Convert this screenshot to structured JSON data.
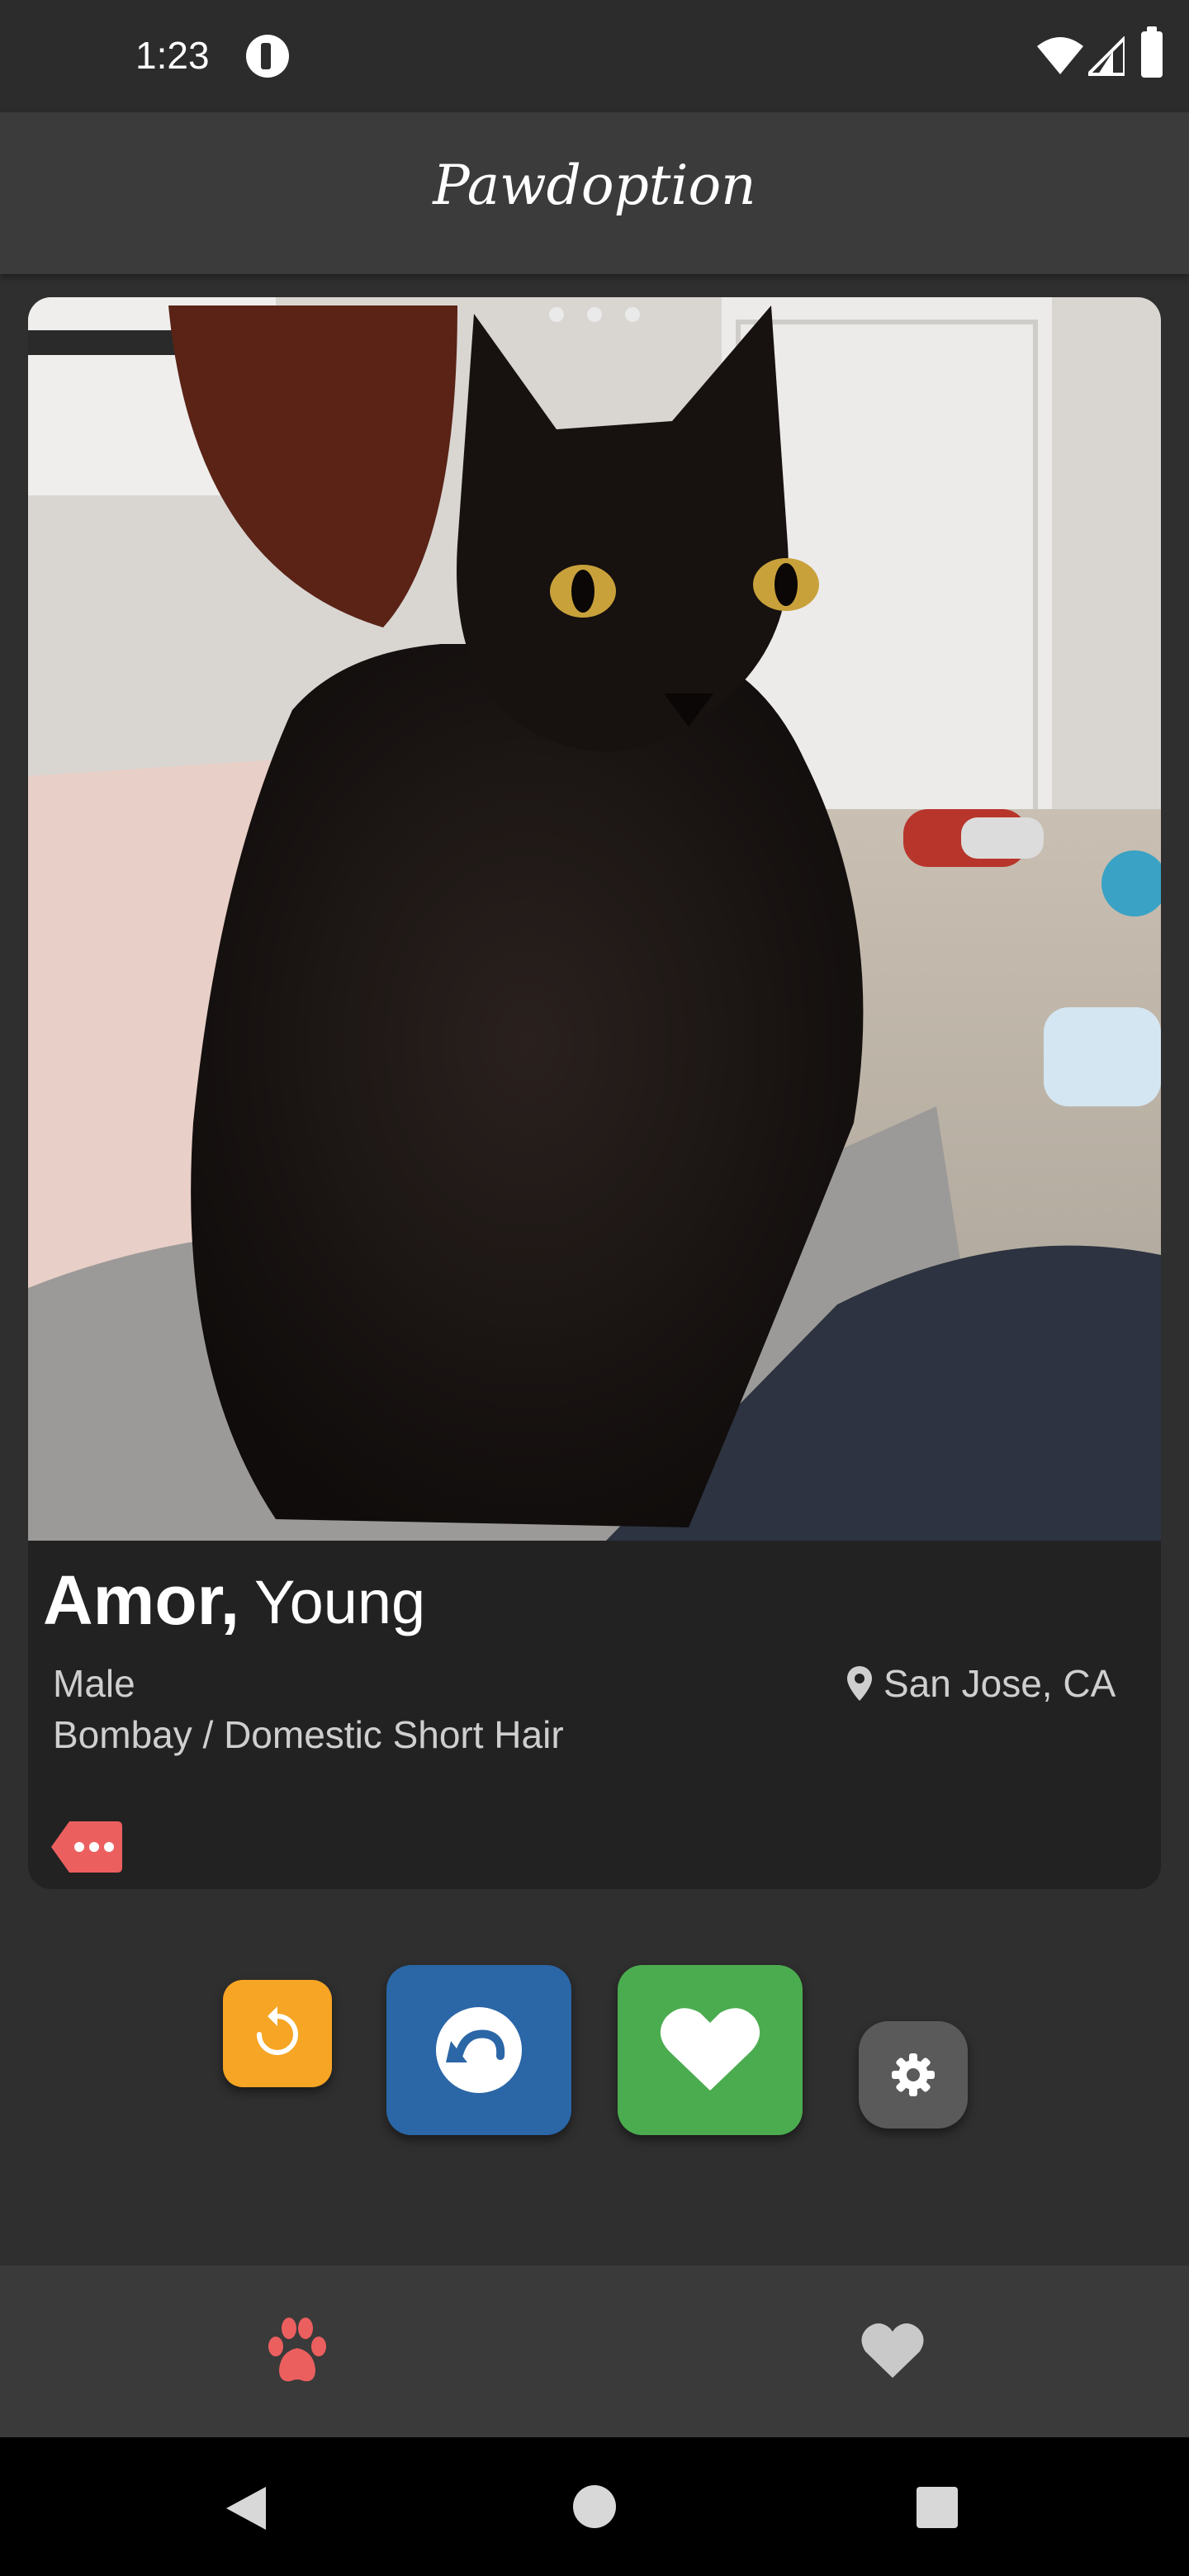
{
  "status_bar": {
    "time": "1:23",
    "icons": [
      "app-notification-icon",
      "wifi-icon",
      "signal-icon",
      "battery-icon"
    ]
  },
  "header": {
    "title": "Pawdoption"
  },
  "card": {
    "photo_page_count": 3,
    "name": "Amor,",
    "age": "Young",
    "sex": "Male",
    "breed": "Bombay / Domestic Short Hair",
    "location": "San Jose, CA",
    "tag_icon": "tag-more-icon"
  },
  "actions": {
    "undo_small": "undo-icon",
    "rewind": "rewind-icon",
    "like": "heart-icon",
    "settings": "gear-icon"
  },
  "bottom_nav": {
    "items": [
      "paw-icon",
      "heart-icon"
    ],
    "active_color": "#ec5f5f"
  },
  "colors": {
    "accent_orange": "#f6a524",
    "accent_blue": "#2b66a6",
    "accent_green": "#4bac4f",
    "accent_red": "#ec5f5f"
  }
}
